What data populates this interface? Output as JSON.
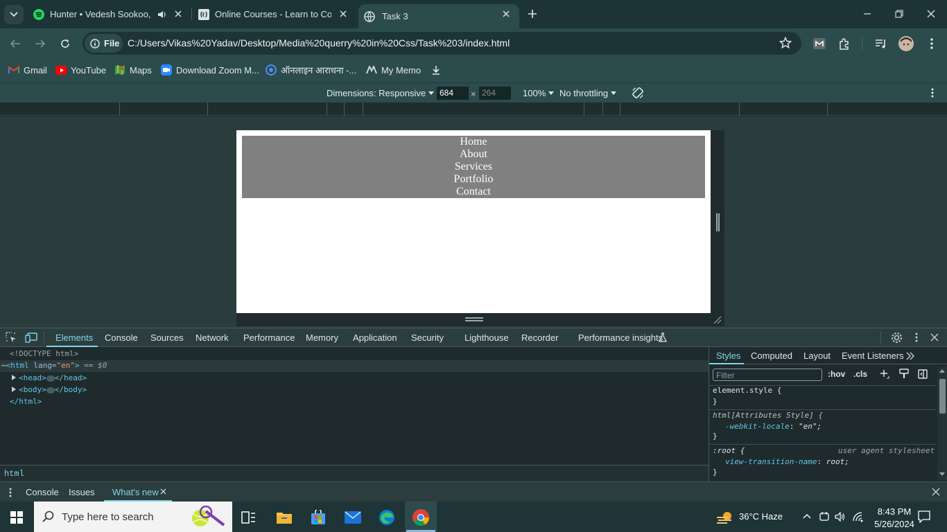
{
  "browser": {
    "tabs": [
      {
        "title": "Hunter • Vedesh Sookoo, R"
      },
      {
        "title": "Online Courses - Learn to Code"
      },
      {
        "title": "Task 3"
      }
    ],
    "address": {
      "scheme_label": "File",
      "url": "C:/Users/Vikas%20Yadav/Desktop/Media%20querry%20in%20Css/Task%203/index.html"
    },
    "bookmarks": [
      {
        "label": "Gmail",
        "icon": "gmail-icon"
      },
      {
        "label": "YouTube",
        "icon": "youtube-icon"
      },
      {
        "label": "Maps",
        "icon": "maps-icon"
      },
      {
        "label": "Download Zoom M...",
        "icon": "zoom-icon"
      },
      {
        "label": "ऑनलाइन आराधना -...",
        "icon": "globe-icon"
      },
      {
        "label": "My Memo",
        "icon": "memo-icon"
      }
    ]
  },
  "device_toolbar": {
    "dimensions_label": "Dimensions: Responsive",
    "width": "684",
    "height": "264",
    "times": "×",
    "zoom": "100%",
    "throttling": "No throttling"
  },
  "page": {
    "nav_links": [
      "Home",
      "About",
      "Services",
      "Portfolio",
      "Contact"
    ]
  },
  "devtools": {
    "tabs": [
      "Elements",
      "Console",
      "Sources",
      "Network",
      "Performance",
      "Memory",
      "Application",
      "Security",
      "Lighthouse",
      "Recorder",
      "Performance insights"
    ],
    "active_tab": "Elements",
    "elements": {
      "doctype": "<!DOCTYPE html>",
      "html_open_tag": "html",
      "html_attr_name": "lang",
      "html_attr_value": "\"en\"",
      "selected_suffix": "== $0",
      "head": "head",
      "body": "body",
      "html_close": "</html>"
    },
    "breadcrumb": "html",
    "styles_tabs": [
      "Styles",
      "Computed",
      "Layout",
      "Event Listeners"
    ],
    "filter_placeholder": "Filter",
    "hov": ":hov",
    "cls": ".cls",
    "rules": {
      "element_style": "element.style {",
      "close": "}",
      "attr_style_selector": "html[Attributes Style] {",
      "locale_prop": "-webkit-locale",
      "locale_val": "\"en\";",
      "root_selector": ":root {",
      "ua_label": "user agent stylesheet",
      "vt_prop": "view-transition-name",
      "vt_val": "root;"
    },
    "drawer_tabs": [
      "Console",
      "Issues",
      "What's new"
    ]
  },
  "taskbar": {
    "search_placeholder": "Type here to search",
    "weather": "36°C  Haze",
    "time": "8:43 PM",
    "date": "5/26/2024"
  }
}
